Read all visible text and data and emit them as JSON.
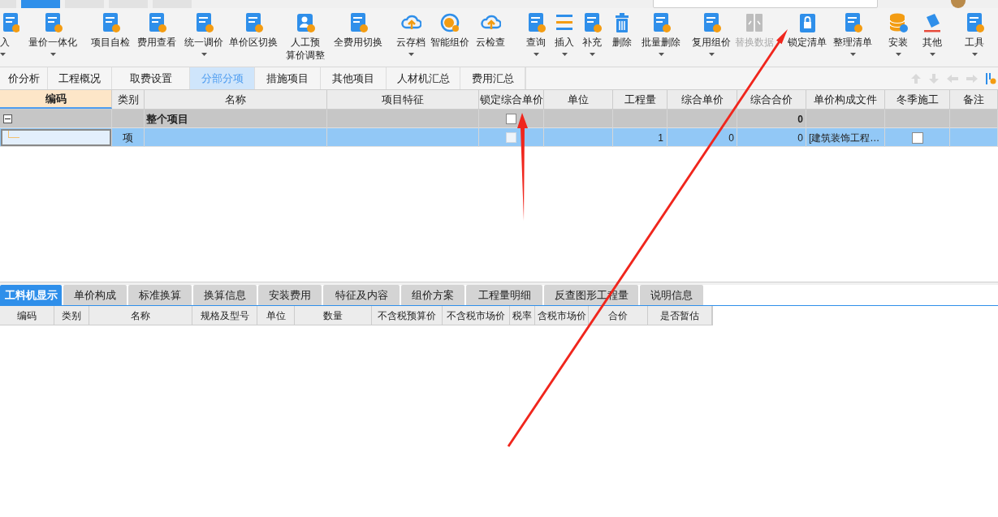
{
  "menu": [
    {
      "selected": false
    },
    {
      "selected": true
    },
    {
      "selected": false
    },
    {
      "selected": false
    },
    {
      "selected": false
    }
  ],
  "toolbar": [
    {
      "label": "入",
      "dropdown": true,
      "disabled": false
    },
    {
      "label": "量价一体化",
      "dropdown": true,
      "disabled": false
    },
    {
      "label": "项目自检",
      "dropdown": false,
      "disabled": false
    },
    {
      "label": "费用查看",
      "dropdown": false,
      "disabled": false
    },
    {
      "label": "统一调价",
      "dropdown": true,
      "disabled": false
    },
    {
      "label": "单价区切换",
      "dropdown": false,
      "disabled": false
    },
    {
      "label": "人工预算价调整",
      "dropdown": false,
      "disabled": false
    },
    {
      "label": "全费用切换",
      "dropdown": false,
      "disabled": false
    },
    {
      "label": "云存档",
      "dropdown": true,
      "disabled": false
    },
    {
      "label": "智能组价",
      "dropdown": false,
      "disabled": false
    },
    {
      "label": "云检查",
      "dropdown": false,
      "disabled": false
    },
    {
      "label": "查询",
      "dropdown": true,
      "disabled": false
    },
    {
      "label": "插入",
      "dropdown": true,
      "disabled": false
    },
    {
      "label": "补充",
      "dropdown": true,
      "disabled": false
    },
    {
      "label": "删除",
      "dropdown": false,
      "disabled": false
    },
    {
      "label": "批量删除",
      "dropdown": true,
      "disabled": false
    },
    {
      "label": "复用组价",
      "dropdown": true,
      "disabled": false
    },
    {
      "label": "替换数据",
      "dropdown": false,
      "disabled": true
    },
    {
      "label": "锁定清单",
      "dropdown": false,
      "disabled": false
    },
    {
      "label": "整理清单",
      "dropdown": true,
      "disabled": false
    },
    {
      "label": "安装",
      "dropdown": true,
      "disabled": false
    },
    {
      "label": "其他",
      "dropdown": true,
      "disabled": false
    },
    {
      "label": "工具",
      "dropdown": true,
      "disabled": false
    }
  ],
  "tabs": [
    {
      "label": "价分析",
      "selected": false
    },
    {
      "label": "工程概况",
      "selected": false
    },
    {
      "label": "取费设置",
      "selected": false
    },
    {
      "label": "分部分项",
      "selected": true
    },
    {
      "label": "措施项目",
      "selected": false
    },
    {
      "label": "其他项目",
      "selected": false
    },
    {
      "label": "人材机汇总",
      "selected": false
    },
    {
      "label": "费用汇总",
      "selected": false
    }
  ],
  "table": {
    "columns": [
      "编码",
      "类别",
      "名称",
      "项目特征",
      "锁定综合单价",
      "单位",
      "工程量",
      "综合单价",
      "综合合价",
      "单价构成文件",
      "冬季施工",
      "备注"
    ],
    "rows": [
      {
        "kind": "group",
        "expanded": true,
        "name": "整个项目",
        "locked": false,
        "total": "0"
      },
      {
        "kind": "item",
        "selected": true,
        "type": "项",
        "locked": false,
        "quantity": "1",
        "unit_price": "0",
        "total": "0",
        "price_file": "[建筑装饰工程…",
        "winter": false
      }
    ]
  },
  "bottom_tabs": [
    {
      "label": "工料机显示",
      "selected": true
    },
    {
      "label": "单价构成",
      "selected": false
    },
    {
      "label": "标准换算",
      "selected": false
    },
    {
      "label": "换算信息",
      "selected": false
    },
    {
      "label": "安装费用",
      "selected": false
    },
    {
      "label": "特征及内容",
      "selected": false
    },
    {
      "label": "组价方案",
      "selected": false
    },
    {
      "label": "工程量明细",
      "selected": false
    },
    {
      "label": "反查图形工程量",
      "selected": false
    },
    {
      "label": "说明信息",
      "selected": false
    }
  ],
  "bottom_table": {
    "columns": [
      "编码",
      "类别",
      "名称",
      "规格及型号",
      "单位",
      "数量",
      "不含税预算价",
      "不含税市场价",
      "税率",
      "含税市场价",
      "合价",
      "是否暂估"
    ]
  }
}
